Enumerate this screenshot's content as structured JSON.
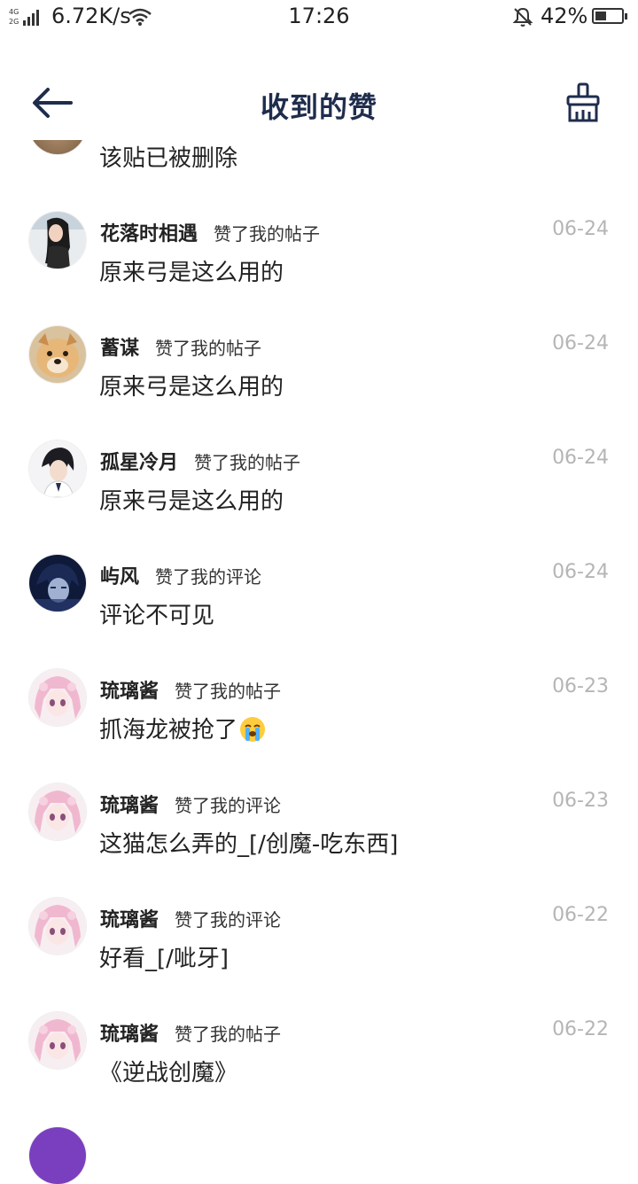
{
  "status_bar": {
    "network_top": "4G",
    "network_bottom": "2G",
    "speed": "6.72K/s",
    "time": "17:26",
    "battery": "42%"
  },
  "header": {
    "title": "收到的赞",
    "back_icon": "arrow-left-icon",
    "clear_icon": "broom-icon"
  },
  "partial_top_item": {
    "content": "该贴已被删除"
  },
  "items": [
    {
      "user": "花落时相遇",
      "action": "赞了我的帖子",
      "date": "06-24",
      "content": "原来弓是这么用的"
    },
    {
      "user": "蓄谋",
      "action": "赞了我的帖子",
      "date": "06-24",
      "content": "原来弓是这么用的"
    },
    {
      "user": "孤星冷月",
      "action": "赞了我的帖子",
      "date": "06-24",
      "content": "原来弓是这么用的"
    },
    {
      "user": "屿风",
      "action": "赞了我的评论",
      "date": "06-24",
      "content": "评论不可见"
    },
    {
      "user": "琉璃酱",
      "action": "赞了我的帖子",
      "date": "06-23",
      "content": "抓海龙被抢了"
    },
    {
      "user": "琉璃酱",
      "action": "赞了我的评论",
      "date": "06-23",
      "content": "这猫怎么弄的_[/创魔-吃东西]"
    },
    {
      "user": "琉璃酱",
      "action": "赞了我的评论",
      "date": "06-22",
      "content": "好看_[/呲牙]"
    },
    {
      "user": "琉璃酱",
      "action": "赞了我的帖子",
      "date": "06-22",
      "content": "《逆战创魔》"
    }
  ],
  "colors": {
    "title": "#1f2d4d",
    "date": "#b5b5b5",
    "text": "#222222"
  }
}
